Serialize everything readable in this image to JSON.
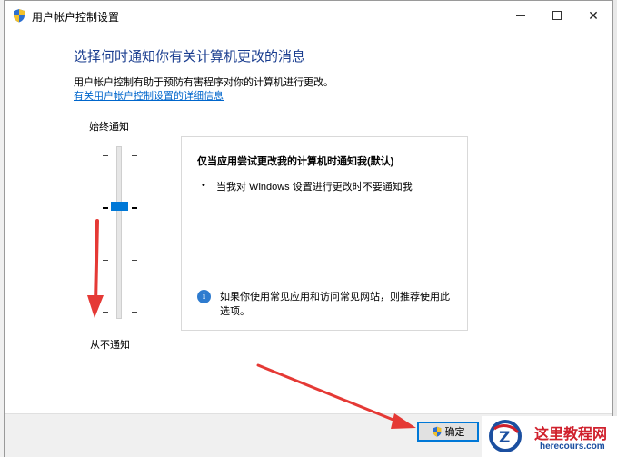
{
  "window": {
    "title": "用户帐户控制设置"
  },
  "header": {
    "heading": "选择何时通知你有关计算机更改的消息",
    "description": "用户帐户控制有助于预防有害程序对你的计算机进行更改。",
    "link": "有关用户帐户控制设置的详细信息"
  },
  "slider": {
    "top_label": "始终通知",
    "bottom_label": "从不通知",
    "level": 2,
    "levels": 4
  },
  "panel": {
    "title": "仅当应用尝试更改我的计算机时通知我(默认)",
    "bullet": "当我对 Windows 设置进行更改时不要通知我",
    "info_line1": "如果你使用常见应用和访问常见网站，则推荐使用此",
    "info_line2": "选项。"
  },
  "footer": {
    "ok_label": "确定"
  },
  "watermark": {
    "cn": "这里教程网",
    "en": "herecours.com"
  },
  "colors": {
    "accent": "#0078d7",
    "heading": "#1a3d8f",
    "arrow": "#e53935"
  }
}
